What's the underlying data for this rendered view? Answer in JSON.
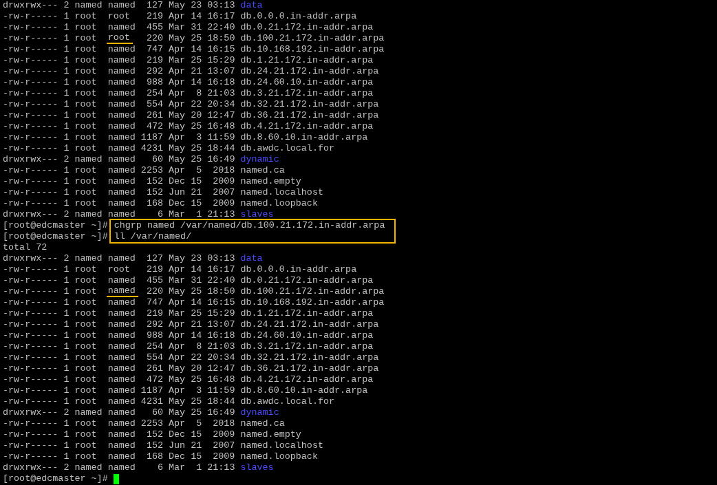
{
  "lines": [
    {
      "kind": "entry",
      "perms": "drwxrwx---",
      "links": "2",
      "owner": "named",
      "group": "named",
      "size": "127",
      "month": "May",
      "day": "23",
      "time": "03:13",
      "name": "data",
      "directory": true,
      "highlighted": false
    },
    {
      "kind": "entry",
      "perms": "-rw-r-----",
      "links": "1",
      "owner": "root",
      "group": "root",
      "size": "219",
      "month": "Apr",
      "day": "14",
      "time": "16:17",
      "name": "db.0.0.0.in-addr.arpa",
      "directory": false,
      "highlighted": false
    },
    {
      "kind": "entry",
      "perms": "-rw-r-----",
      "links": "1",
      "owner": "root",
      "group": "named",
      "size": "455",
      "month": "Mar",
      "day": "31",
      "time": "22:40",
      "name": "db.0.21.172.in-addr.arpa",
      "directory": false,
      "highlighted": false
    },
    {
      "kind": "entry",
      "perms": "-rw-r-----",
      "links": "1",
      "owner": "root",
      "group": "root",
      "size": "220",
      "month": "May",
      "day": "25",
      "time": "18:50",
      "name": "db.100.21.172.in-addr.arpa",
      "directory": false,
      "highlighted": true
    },
    {
      "kind": "entry",
      "perms": "-rw-r-----",
      "links": "1",
      "owner": "root",
      "group": "named",
      "size": "747",
      "month": "Apr",
      "day": "14",
      "time": "16:15",
      "name": "db.10.168.192.in-addr.arpa",
      "directory": false,
      "highlighted": false
    },
    {
      "kind": "entry",
      "perms": "-rw-r-----",
      "links": "1",
      "owner": "root",
      "group": "named",
      "size": "219",
      "month": "Mar",
      "day": "25",
      "time": "15:29",
      "name": "db.1.21.172.in-addr.arpa",
      "directory": false,
      "highlighted": false
    },
    {
      "kind": "entry",
      "perms": "-rw-r-----",
      "links": "1",
      "owner": "root",
      "group": "named",
      "size": "292",
      "month": "Apr",
      "day": "21",
      "time": "13:07",
      "name": "db.24.21.172.in-addr.arpa",
      "directory": false,
      "highlighted": false
    },
    {
      "kind": "entry",
      "perms": "-rw-r-----",
      "links": "1",
      "owner": "root",
      "group": "named",
      "size": "988",
      "month": "Apr",
      "day": "14",
      "time": "16:18",
      "name": "db.24.60.10.in-addr.arpa",
      "directory": false,
      "highlighted": false
    },
    {
      "kind": "entry",
      "perms": "-rw-r-----",
      "links": "1",
      "owner": "root",
      "group": "named",
      "size": "254",
      "month": "Apr",
      "day": "8",
      "time": "21:03",
      "name": "db.3.21.172.in-addr.arpa",
      "directory": false,
      "highlighted": false
    },
    {
      "kind": "entry",
      "perms": "-rw-r-----",
      "links": "1",
      "owner": "root",
      "group": "named",
      "size": "554",
      "month": "Apr",
      "day": "22",
      "time": "20:34",
      "name": "db.32.21.172.in-addr.arpa",
      "directory": false,
      "highlighted": false
    },
    {
      "kind": "entry",
      "perms": "-rw-r-----",
      "links": "1",
      "owner": "root",
      "group": "named",
      "size": "261",
      "month": "May",
      "day": "20",
      "time": "12:47",
      "name": "db.36.21.172.in-addr.arpa",
      "directory": false,
      "highlighted": false
    },
    {
      "kind": "entry",
      "perms": "-rw-r-----",
      "links": "1",
      "owner": "root",
      "group": "named",
      "size": "472",
      "month": "May",
      "day": "25",
      "time": "16:48",
      "name": "db.4.21.172.in-addr.arpa",
      "directory": false,
      "highlighted": false
    },
    {
      "kind": "entry",
      "perms": "-rw-r-----",
      "links": "1",
      "owner": "root",
      "group": "named",
      "size": "1187",
      "month": "Apr",
      "day": "3",
      "time": "11:59",
      "name": "db.8.60.10.in-addr.arpa",
      "directory": false,
      "highlighted": false
    },
    {
      "kind": "entry",
      "perms": "-rw-r-----",
      "links": "1",
      "owner": "root",
      "group": "named",
      "size": "4231",
      "month": "May",
      "day": "25",
      "time": "18:44",
      "name": "db.awdc.local.for",
      "directory": false,
      "highlighted": false
    },
    {
      "kind": "entry",
      "perms": "drwxrwx---",
      "links": "2",
      "owner": "named",
      "group": "named",
      "size": "60",
      "month": "May",
      "day": "25",
      "time": "16:49",
      "name": "dynamic",
      "directory": true,
      "highlighted": false
    },
    {
      "kind": "entry",
      "perms": "-rw-r-----",
      "links": "1",
      "owner": "root",
      "group": "named",
      "size": "2253",
      "month": "Apr",
      "day": "5",
      "time": "2018",
      "name": "named.ca",
      "directory": false,
      "highlighted": false
    },
    {
      "kind": "entry",
      "perms": "-rw-r-----",
      "links": "1",
      "owner": "root",
      "group": "named",
      "size": "152",
      "month": "Dec",
      "day": "15",
      "time": "2009",
      "name": "named.empty",
      "directory": false,
      "highlighted": false
    },
    {
      "kind": "entry",
      "perms": "-rw-r-----",
      "links": "1",
      "owner": "root",
      "group": "named",
      "size": "152",
      "month": "Jun",
      "day": "21",
      "time": "2007",
      "name": "named.localhost",
      "directory": false,
      "highlighted": false
    },
    {
      "kind": "entry",
      "perms": "-rw-r-----",
      "links": "1",
      "owner": "root",
      "group": "named",
      "size": "168",
      "month": "Dec",
      "day": "15",
      "time": "2009",
      "name": "named.loopback",
      "directory": false,
      "highlighted": false
    },
    {
      "kind": "entry",
      "perms": "drwxrwx---",
      "links": "2",
      "owner": "named",
      "group": "named",
      "size": "6",
      "month": "Mar",
      "day": "1",
      "time": "21:13",
      "name": "slaves",
      "directory": true,
      "highlighted": false
    },
    {
      "kind": "commands",
      "highlighted": true,
      "commands": [
        {
          "prompt": "[root@edcmaster ~]#",
          "command": "chgrp named /var/named/db.100.21.172.in-addr.arpa"
        },
        {
          "prompt": "[root@edcmaster ~]#",
          "command": "ll /var/named/"
        }
      ]
    },
    {
      "kind": "text",
      "text": "total 72"
    },
    {
      "kind": "entry",
      "perms": "drwxrwx---",
      "links": "2",
      "owner": "named",
      "group": "named",
      "size": "127",
      "month": "May",
      "day": "23",
      "time": "03:13",
      "name": "data",
      "directory": true,
      "highlighted": false
    },
    {
      "kind": "entry",
      "perms": "-rw-r-----",
      "links": "1",
      "owner": "root",
      "group": "root",
      "size": "219",
      "month": "Apr",
      "day": "14",
      "time": "16:17",
      "name": "db.0.0.0.in-addr.arpa",
      "directory": false,
      "highlighted": false
    },
    {
      "kind": "entry",
      "perms": "-rw-r-----",
      "links": "1",
      "owner": "root",
      "group": "named",
      "size": "455",
      "month": "Mar",
      "day": "31",
      "time": "22:40",
      "name": "db.0.21.172.in-addr.arpa",
      "directory": false,
      "highlighted": false
    },
    {
      "kind": "entry",
      "perms": "-rw-r-----",
      "links": "1",
      "owner": "root",
      "group": "named",
      "size": "220",
      "month": "May",
      "day": "25",
      "time": "18:50",
      "name": "db.100.21.172.in-addr.arpa",
      "directory": false,
      "highlighted": true
    },
    {
      "kind": "entry",
      "perms": "-rw-r-----",
      "links": "1",
      "owner": "root",
      "group": "named",
      "size": "747",
      "month": "Apr",
      "day": "14",
      "time": "16:15",
      "name": "db.10.168.192.in-addr.arpa",
      "directory": false,
      "highlighted": false
    },
    {
      "kind": "entry",
      "perms": "-rw-r-----",
      "links": "1",
      "owner": "root",
      "group": "named",
      "size": "219",
      "month": "Mar",
      "day": "25",
      "time": "15:29",
      "name": "db.1.21.172.in-addr.arpa",
      "directory": false,
      "highlighted": false
    },
    {
      "kind": "entry",
      "perms": "-rw-r-----",
      "links": "1",
      "owner": "root",
      "group": "named",
      "size": "292",
      "month": "Apr",
      "day": "21",
      "time": "13:07",
      "name": "db.24.21.172.in-addr.arpa",
      "directory": false,
      "highlighted": false
    },
    {
      "kind": "entry",
      "perms": "-rw-r-----",
      "links": "1",
      "owner": "root",
      "group": "named",
      "size": "988",
      "month": "Apr",
      "day": "14",
      "time": "16:18",
      "name": "db.24.60.10.in-addr.arpa",
      "directory": false,
      "highlighted": false
    },
    {
      "kind": "entry",
      "perms": "-rw-r-----",
      "links": "1",
      "owner": "root",
      "group": "named",
      "size": "254",
      "month": "Apr",
      "day": "8",
      "time": "21:03",
      "name": "db.3.21.172.in-addr.arpa",
      "directory": false,
      "highlighted": false
    },
    {
      "kind": "entry",
      "perms": "-rw-r-----",
      "links": "1",
      "owner": "root",
      "group": "named",
      "size": "554",
      "month": "Apr",
      "day": "22",
      "time": "20:34",
      "name": "db.32.21.172.in-addr.arpa",
      "directory": false,
      "highlighted": false
    },
    {
      "kind": "entry",
      "perms": "-rw-r-----",
      "links": "1",
      "owner": "root",
      "group": "named",
      "size": "261",
      "month": "May",
      "day": "20",
      "time": "12:47",
      "name": "db.36.21.172.in-addr.arpa",
      "directory": false,
      "highlighted": false
    },
    {
      "kind": "entry",
      "perms": "-rw-r-----",
      "links": "1",
      "owner": "root",
      "group": "named",
      "size": "472",
      "month": "May",
      "day": "25",
      "time": "16:48",
      "name": "db.4.21.172.in-addr.arpa",
      "directory": false,
      "highlighted": false
    },
    {
      "kind": "entry",
      "perms": "-rw-r-----",
      "links": "1",
      "owner": "root",
      "group": "named",
      "size": "1187",
      "month": "Apr",
      "day": "3",
      "time": "11:59",
      "name": "db.8.60.10.in-addr.arpa",
      "directory": false,
      "highlighted": false
    },
    {
      "kind": "entry",
      "perms": "-rw-r-----",
      "links": "1",
      "owner": "root",
      "group": "named",
      "size": "4231",
      "month": "May",
      "day": "25",
      "time": "18:44",
      "name": "db.awdc.local.for",
      "directory": false,
      "highlighted": false
    },
    {
      "kind": "entry",
      "perms": "drwxrwx---",
      "links": "2",
      "owner": "named",
      "group": "named",
      "size": "60",
      "month": "May",
      "day": "25",
      "time": "16:49",
      "name": "dynamic",
      "directory": true,
      "highlighted": false
    },
    {
      "kind": "entry",
      "perms": "-rw-r-----",
      "links": "1",
      "owner": "root",
      "group": "named",
      "size": "2253",
      "month": "Apr",
      "day": "5",
      "time": "2018",
      "name": "named.ca",
      "directory": false,
      "highlighted": false
    },
    {
      "kind": "entry",
      "perms": "-rw-r-----",
      "links": "1",
      "owner": "root",
      "group": "named",
      "size": "152",
      "month": "Dec",
      "day": "15",
      "time": "2009",
      "name": "named.empty",
      "directory": false,
      "highlighted": false
    },
    {
      "kind": "entry",
      "perms": "-rw-r-----",
      "links": "1",
      "owner": "root",
      "group": "named",
      "size": "152",
      "month": "Jun",
      "day": "21",
      "time": "2007",
      "name": "named.localhost",
      "directory": false,
      "highlighted": false
    },
    {
      "kind": "entry",
      "perms": "-rw-r-----",
      "links": "1",
      "owner": "root",
      "group": "named",
      "size": "168",
      "month": "Dec",
      "day": "15",
      "time": "2009",
      "name": "named.loopback",
      "directory": false,
      "highlighted": false
    },
    {
      "kind": "entry",
      "perms": "drwxrwx---",
      "links": "2",
      "owner": "named",
      "group": "named",
      "size": "6",
      "month": "Mar",
      "day": "1",
      "time": "21:13",
      "name": "slaves",
      "directory": true,
      "highlighted": false
    },
    {
      "kind": "prompt",
      "prompt": "[root@edcmaster ~]#",
      "cursor": true
    }
  ]
}
